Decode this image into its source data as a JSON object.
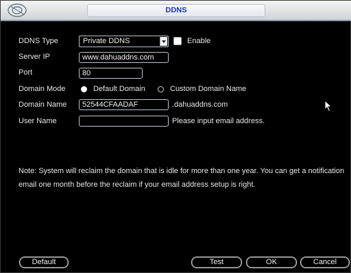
{
  "window": {
    "title": "DDNS"
  },
  "form": {
    "ddns_type_label": "DDNS Type",
    "ddns_type_value": "Private DDNS",
    "enable_label": "Enable",
    "server_ip_label": "Server IP",
    "server_ip_value": "www.dahuaddns.com",
    "port_label": "Port",
    "port_value": "80",
    "domain_mode_label": "Domain Mode",
    "domain_mode_options": [
      "Default Domain",
      "Custom Domain Name"
    ],
    "domain_mode_selected": "Default Domain",
    "domain_name_label": "Domain Name",
    "domain_name_value": "52544CFAADAF",
    "domain_suffix": ".dahuaddns.com",
    "user_name_label": "User Name",
    "user_name_value": "",
    "user_name_hint": "Please input email address."
  },
  "note": "Note: System will reclaim the domain that is idle for more than one year. You can get a notification email one month before the reclaim if your email address setup is right.",
  "buttons": {
    "default": "Default",
    "test": "Test",
    "ok": "OK",
    "cancel": "Cancel"
  },
  "colors": {
    "title_text": "#1a2fbe",
    "background": "#000000",
    "field_border": "#bfc6d0"
  },
  "icons": {
    "logo": "camera-lens-logo-icon",
    "cursor": "mouse-pointer-icon"
  }
}
